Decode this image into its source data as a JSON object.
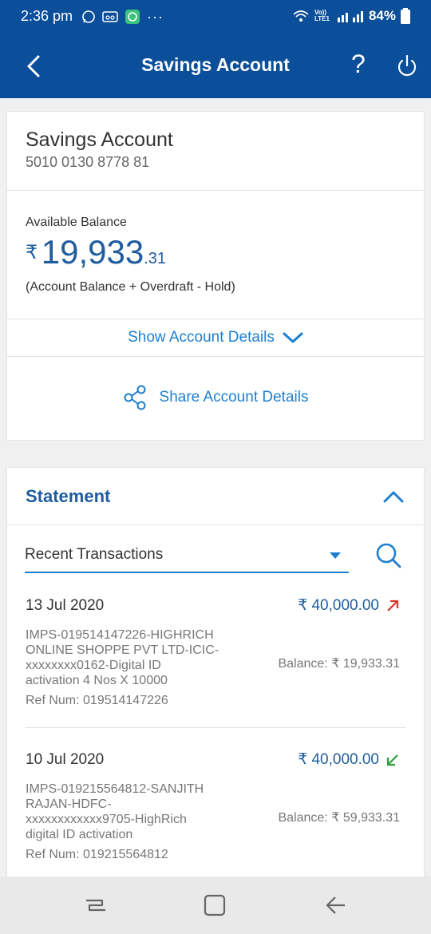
{
  "status_bar": {
    "time": "2:36 pm",
    "more": "···",
    "battery": "84%",
    "network_label": "Vo)) LTE1"
  },
  "header": {
    "title": "Savings Account",
    "help": "?"
  },
  "account": {
    "name": "Savings Account",
    "number": "5010 0130 8778 81",
    "balance_label": "Available Balance",
    "currency": "₹",
    "balance_main": "19,933",
    "balance_decimal": ".31",
    "balance_note": "(Account Balance + Overdraft - Hold)",
    "show_details": "Show Account Details",
    "share_details": "Share Account Details"
  },
  "statement": {
    "title": "Statement",
    "filter_selected": "Recent Transactions",
    "transactions": [
      {
        "date": "13 Jul 2020",
        "amount": "₹ 40,000.00",
        "direction": "debit",
        "desc": [
          "IMPS-019514147226-HIGHRICH",
          "ONLINE SHOPPE PVT LTD-ICIC-",
          "xxxxxxxx0162-Digital ID",
          "activation 4 Nos X 10000"
        ],
        "balance": "Balance: ₹ 19,933.31",
        "ref": "Ref Num: 019514147226"
      },
      {
        "date": "10 Jul 2020",
        "amount": "₹ 40,000.00",
        "direction": "credit",
        "desc": [
          "IMPS-019215564812-SANJITH",
          "RAJAN-HDFC-",
          "xxxxxxxxxxxx9705-HighRich",
          "digital ID activation"
        ],
        "balance": "Balance: ₹ 59,933.31",
        "ref": "Ref Num: 019215564812"
      }
    ]
  },
  "colors": {
    "brand_blue": "#0b4e9a",
    "link_blue": "#1e7fd0",
    "debit_red": "#d8392b",
    "credit_green": "#2e9e3e"
  },
  "icons": {
    "back": "chevron-left-icon",
    "help": "question-icon",
    "power": "power-icon",
    "share": "share-icon",
    "chevron_down": "chevron-down-icon",
    "chevron_up": "chevron-up-icon",
    "search": "search-icon",
    "dropdown": "caret-down-icon"
  }
}
